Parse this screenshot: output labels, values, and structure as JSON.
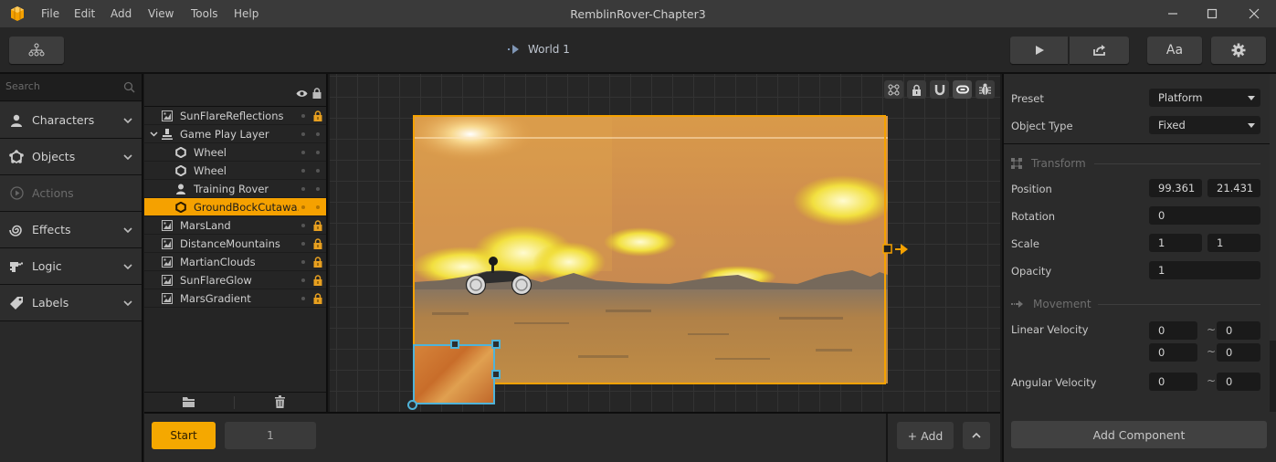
{
  "app": {
    "title": "RemblinRover-Chapter3",
    "menu": [
      "File",
      "Edit",
      "Add",
      "View",
      "Tools",
      "Help"
    ],
    "logo_icon": "app-cube-logo-icon"
  },
  "toolbar": {
    "hierarchy_icon": "hierarchy-tree-icon",
    "world_label": "World 1",
    "play_icon": "play-icon",
    "share_icon": "export-share-icon",
    "font_label": "Aa",
    "settings_icon": "gear-icon"
  },
  "sidebar": {
    "search_placeholder": "Search",
    "items": [
      {
        "label": "Characters",
        "icon": "person-icon",
        "enabled": true
      },
      {
        "label": "Objects",
        "icon": "shape-icon",
        "enabled": true
      },
      {
        "label": "Actions",
        "icon": "play-circle-icon",
        "enabled": false
      },
      {
        "label": "Effects",
        "icon": "spiral-icon",
        "enabled": true
      },
      {
        "label": "Logic",
        "icon": "logic-icon",
        "enabled": true
      },
      {
        "label": "Labels",
        "icon": "tag-icon",
        "enabled": true
      }
    ]
  },
  "layers": {
    "rows": [
      {
        "name": "SunFlareReflections",
        "type": "image",
        "indent": 0,
        "locked": true,
        "selected": false
      },
      {
        "name": "Game Play Layer",
        "type": "layer",
        "indent": 0,
        "locked": false,
        "selected": false,
        "expanded": true
      },
      {
        "name": "Wheel",
        "type": "object",
        "indent": 1,
        "locked": false,
        "selected": false
      },
      {
        "name": "Wheel",
        "type": "object",
        "indent": 1,
        "locked": false,
        "selected": false
      },
      {
        "name": "Training Rover",
        "type": "character",
        "indent": 1,
        "locked": false,
        "selected": false
      },
      {
        "name": "GroundBockCutawa...",
        "type": "object",
        "indent": 1,
        "locked": false,
        "selected": true
      },
      {
        "name": "MarsLand",
        "type": "image",
        "indent": 0,
        "locked": true,
        "selected": false
      },
      {
        "name": "DistanceMountains",
        "type": "image",
        "indent": 0,
        "locked": true,
        "selected": false
      },
      {
        "name": "MartianClouds",
        "type": "image",
        "indent": 0,
        "locked": true,
        "selected": false
      },
      {
        "name": "SunFlareGlow",
        "type": "image",
        "indent": 0,
        "locked": true,
        "selected": false
      },
      {
        "name": "MarsGradient",
        "type": "image",
        "indent": 0,
        "locked": true,
        "selected": false
      }
    ]
  },
  "bottom": {
    "start_label": "Start",
    "page_value": "1",
    "add_label": "+ Add"
  },
  "inspector": {
    "preset_label": "Preset",
    "preset_value": "Platform",
    "object_type_label": "Object Type",
    "object_type_value": "Fixed",
    "transform_title": "Transform",
    "position_label": "Position",
    "position_x": "99.361",
    "position_y": "21.431",
    "rotation_label": "Rotation",
    "rotation_value": "0",
    "scale_label": "Scale",
    "scale_x": "1",
    "scale_y": "1",
    "opacity_label": "Opacity",
    "opacity_value": "1",
    "movement_title": "Movement",
    "linear_velocity_label": "Linear Velocity",
    "linear_velocity": [
      [
        "0",
        "0"
      ],
      [
        "0",
        "0"
      ]
    ],
    "angular_velocity_label": "Angular Velocity",
    "angular_velocity": [
      "0",
      "0"
    ],
    "range_separator": "~",
    "add_component_label": "Add Component"
  },
  "colors": {
    "accent": "#f5a100",
    "selection_blue": "#4fb3d9",
    "lock_color": "#e8a020"
  }
}
